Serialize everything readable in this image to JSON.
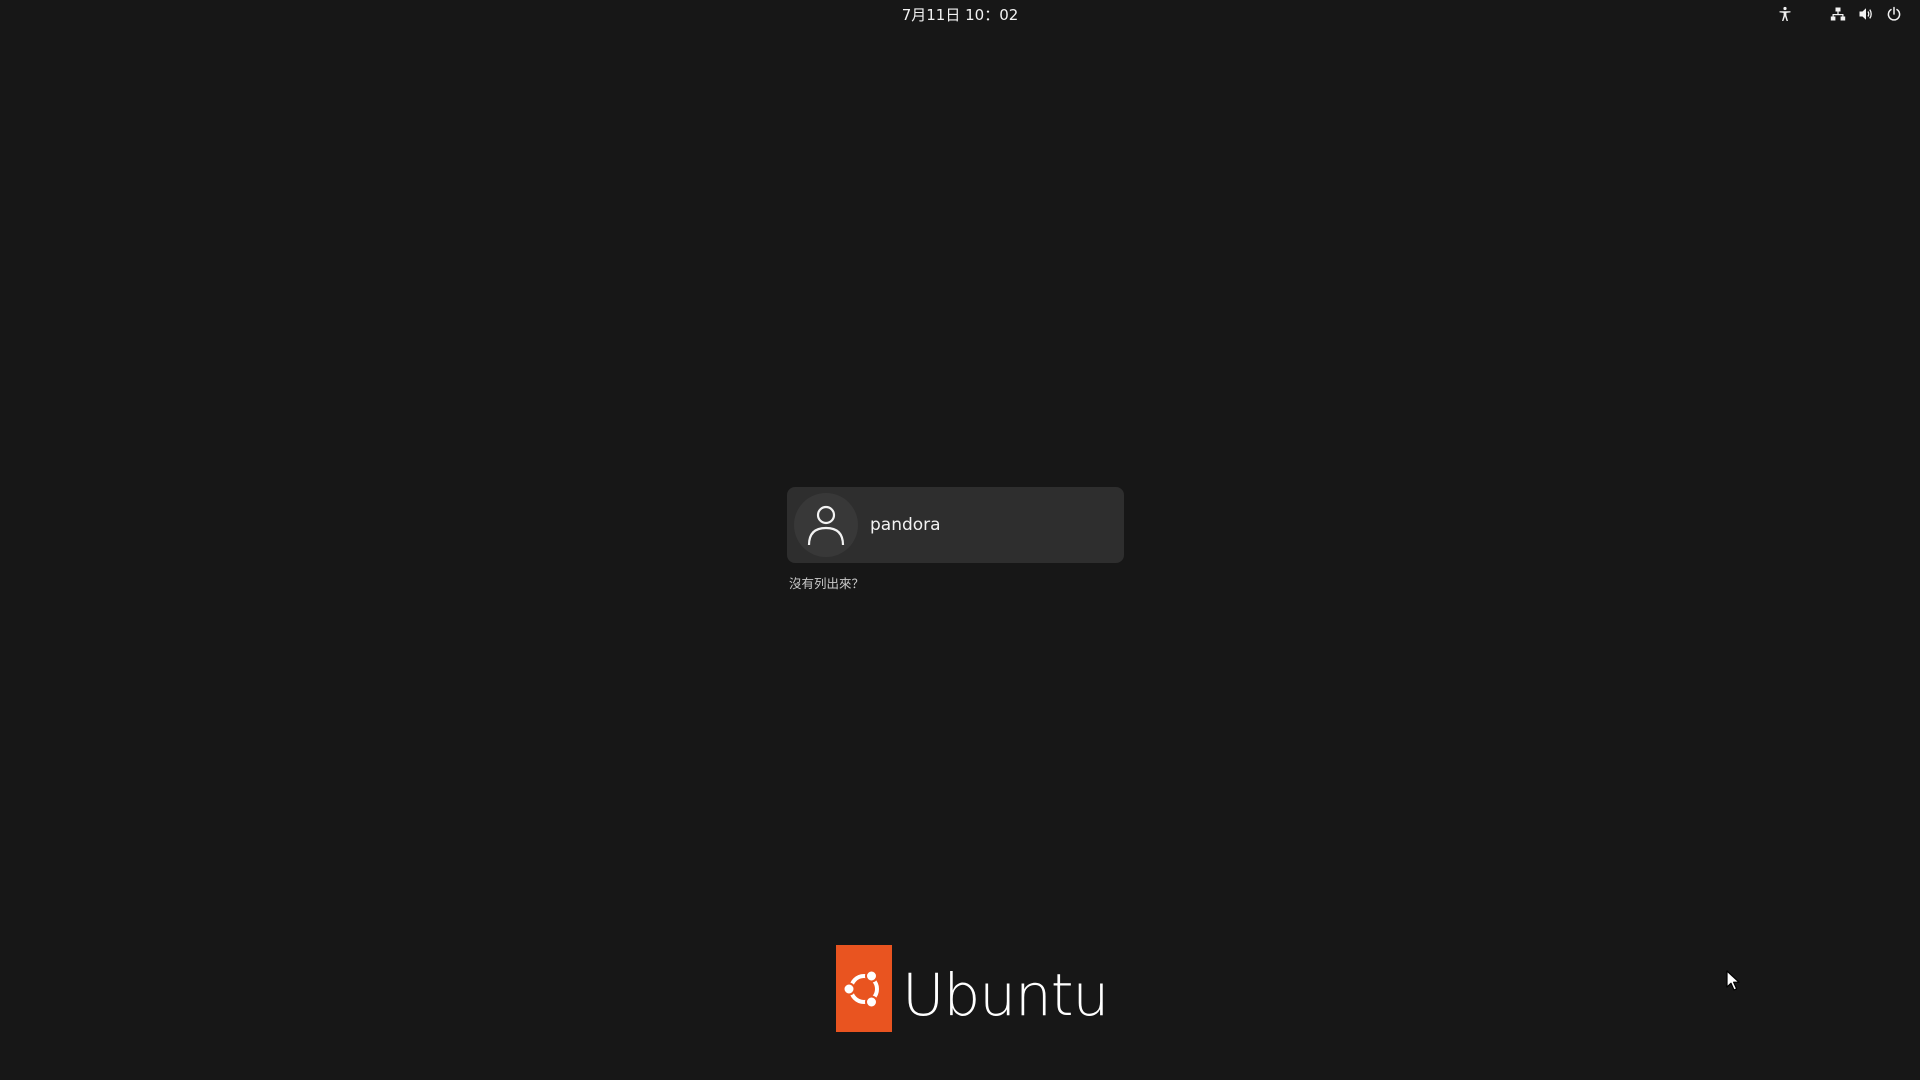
{
  "topbar": {
    "clock": "7月11日 10：02",
    "tray": {
      "accessibility_icon": "accessibility-icon",
      "network_icon": "network-wired-icon",
      "volume_icon": "volume-icon",
      "power_icon": "power-icon"
    }
  },
  "login": {
    "user": {
      "name": "pandora",
      "avatar_icon": "user-icon"
    },
    "not_listed": "沒有列出來？"
  },
  "branding": {
    "logo_text": "Ubuntu",
    "logo_icon": "ubuntu-circle-of-friends-icon",
    "accent_color": "#e95420"
  },
  "colors": {
    "background": "#171717",
    "card": "#2e2e2e"
  }
}
